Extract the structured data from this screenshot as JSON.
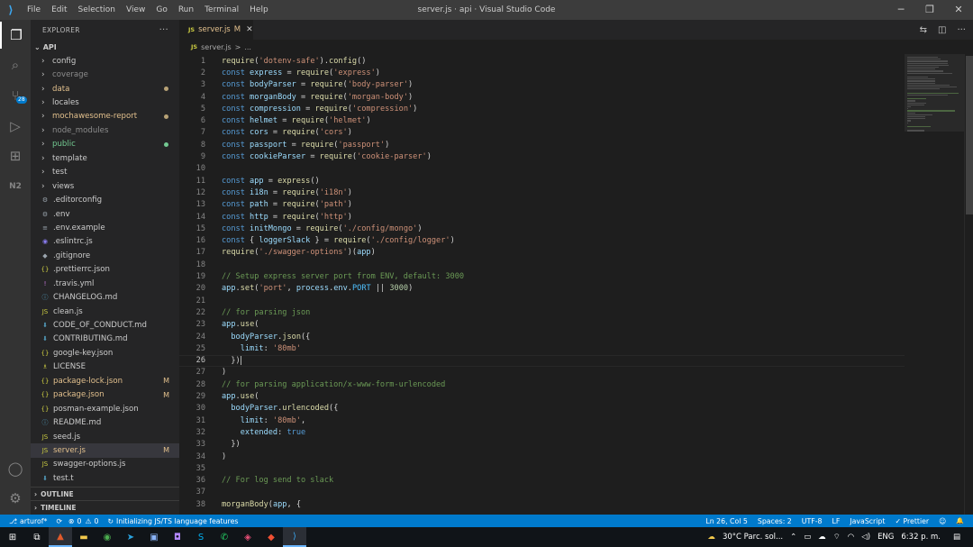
{
  "titlebar": {
    "menu": [
      "File",
      "Edit",
      "Selection",
      "View",
      "Go",
      "Run",
      "Terminal",
      "Help"
    ],
    "title": "server.js · api · Visual Studio Code",
    "icons": [
      "minimize-icon",
      "restore-icon",
      "close-icon"
    ]
  },
  "activity": {
    "icons": [
      "files-icon",
      "search-icon",
      "source-control-icon",
      "run-debug-icon",
      "extensions-icon",
      "api-icon",
      "account-icon",
      "manage-gear-icon"
    ],
    "scm_badge": "28"
  },
  "sidebar": {
    "title": "EXPLORER",
    "more": "···",
    "root": "API",
    "items": [
      {
        "label": "config",
        "type": "folder",
        "color": "#cccccc"
      },
      {
        "label": "coverage",
        "type": "folder",
        "color": "#8c8c8c"
      },
      {
        "label": "data",
        "type": "folder",
        "color": "#e2c08d",
        "dot": "#b8a276"
      },
      {
        "label": "locales",
        "type": "folder",
        "color": "#cccccc"
      },
      {
        "label": "mochawesome-report",
        "type": "folder",
        "color": "#e2c08d",
        "dot": "#b8a276"
      },
      {
        "label": "node_modules",
        "type": "folder",
        "color": "#8c8c8c"
      },
      {
        "label": "public",
        "type": "folder",
        "color": "#73c991",
        "dot": "#73c991"
      },
      {
        "label": "template",
        "type": "folder",
        "color": "#cccccc"
      },
      {
        "label": "test",
        "type": "folder",
        "color": "#cccccc"
      },
      {
        "label": "views",
        "type": "folder",
        "color": "#cccccc"
      },
      {
        "label": ".editorconfig",
        "type": "file",
        "icon": "⚙",
        "icon_color": "#9aa4ad",
        "color": "#cccccc"
      },
      {
        "label": ".env",
        "type": "file",
        "icon": "⚙",
        "icon_color": "#9aa4ad",
        "color": "#cccccc"
      },
      {
        "label": ".env.example",
        "type": "file",
        "icon": "≡",
        "icon_color": "#9aa4ad",
        "color": "#cccccc"
      },
      {
        "label": ".eslintrc.js",
        "type": "file",
        "icon": "◉",
        "icon_color": "#8a7cf0",
        "color": "#cccccc"
      },
      {
        "label": ".gitignore",
        "type": "file",
        "icon": "◆",
        "icon_color": "#9aa4ad",
        "color": "#cccccc"
      },
      {
        "label": ".prettierrc.json",
        "type": "file",
        "icon": "{}",
        "icon_color": "#cbcb41",
        "color": "#cccccc"
      },
      {
        "label": ".travis.yml",
        "type": "file",
        "icon": "!",
        "icon_color": "#c678dd",
        "color": "#cccccc"
      },
      {
        "label": "CHANGELOG.md",
        "type": "file",
        "icon": "ⓘ",
        "icon_color": "#519aba",
        "color": "#cccccc"
      },
      {
        "label": "clean.js",
        "type": "file",
        "icon": "JS",
        "icon_color": "#cbcb41",
        "color": "#cccccc"
      },
      {
        "label": "CODE_OF_CONDUCT.md",
        "type": "file",
        "icon": "⬇",
        "icon_color": "#519aba",
        "color": "#cccccc"
      },
      {
        "label": "CONTRIBUTING.md",
        "type": "file",
        "icon": "⬇",
        "icon_color": "#519aba",
        "color": "#cccccc"
      },
      {
        "label": "google-key.json",
        "type": "file",
        "icon": "{}",
        "icon_color": "#cbcb41",
        "color": "#cccccc"
      },
      {
        "label": "LICENSE",
        "type": "file",
        "icon": "♗",
        "icon_color": "#cbcb41",
        "color": "#cccccc"
      },
      {
        "label": "package-lock.json",
        "type": "file",
        "icon": "{}",
        "icon_color": "#cbcb41",
        "color": "#e2c08d",
        "deco": "M"
      },
      {
        "label": "package.json",
        "type": "file",
        "icon": "{}",
        "icon_color": "#cbcb41",
        "color": "#e2c08d",
        "deco": "M"
      },
      {
        "label": "posman-example.json",
        "type": "file",
        "icon": "{}",
        "icon_color": "#cbcb41",
        "color": "#cccccc"
      },
      {
        "label": "README.md",
        "type": "file",
        "icon": "ⓘ",
        "icon_color": "#519aba",
        "color": "#cccccc"
      },
      {
        "label": "seed.js",
        "type": "file",
        "icon": "JS",
        "icon_color": "#cbcb41",
        "color": "#cccccc"
      },
      {
        "label": "server.js",
        "type": "file",
        "icon": "JS",
        "icon_color": "#cbcb41",
        "color": "#e2c08d",
        "deco": "M",
        "selected": true
      },
      {
        "label": "swagger-options.js",
        "type": "file",
        "icon": "JS",
        "icon_color": "#cbcb41",
        "color": "#cccccc"
      },
      {
        "label": "test.t",
        "type": "file",
        "icon": "⬇",
        "icon_color": "#519aba",
        "color": "#cccccc"
      }
    ],
    "outline": "OUTLINE",
    "timeline": "TIMELINE"
  },
  "tab": {
    "icon": "JS",
    "name": "server.js",
    "status": "M",
    "close": "✕"
  },
  "breadcrumb": {
    "icon": "JS",
    "file": "server.js",
    "sep": ">",
    "rest": "..."
  },
  "editor_action_icons": [
    "compare-icon",
    "split-editor-icon",
    "more-actions-icon"
  ],
  "code": {
    "current_line": 26,
    "lines": [
      [
        [
          "f",
          "require"
        ],
        [
          "p",
          "("
        ],
        [
          "s",
          "'dotenv-safe'"
        ],
        [
          "p",
          ")."
        ],
        [
          "f",
          "config"
        ],
        [
          "p",
          "()"
        ]
      ],
      [
        [
          "k",
          "const "
        ],
        [
          "v",
          "express"
        ],
        [
          "p",
          " = "
        ],
        [
          "f",
          "require"
        ],
        [
          "p",
          "("
        ],
        [
          "s",
          "'express'"
        ],
        [
          "p",
          ")"
        ]
      ],
      [
        [
          "k",
          "const "
        ],
        [
          "v",
          "bodyParser"
        ],
        [
          "p",
          " = "
        ],
        [
          "f",
          "require"
        ],
        [
          "p",
          "("
        ],
        [
          "s",
          "'body-parser'"
        ],
        [
          "p",
          ")"
        ]
      ],
      [
        [
          "k",
          "const "
        ],
        [
          "v",
          "morganBody"
        ],
        [
          "p",
          " = "
        ],
        [
          "f",
          "require"
        ],
        [
          "p",
          "("
        ],
        [
          "s",
          "'morgan-body'"
        ],
        [
          "p",
          ")"
        ]
      ],
      [
        [
          "k",
          "const "
        ],
        [
          "v",
          "compression"
        ],
        [
          "p",
          " = "
        ],
        [
          "f",
          "require"
        ],
        [
          "p",
          "("
        ],
        [
          "s",
          "'compression'"
        ],
        [
          "p",
          ")"
        ]
      ],
      [
        [
          "k",
          "const "
        ],
        [
          "v",
          "helmet"
        ],
        [
          "p",
          " = "
        ],
        [
          "f",
          "require"
        ],
        [
          "p",
          "("
        ],
        [
          "s",
          "'helmet'"
        ],
        [
          "p",
          ")"
        ]
      ],
      [
        [
          "k",
          "const "
        ],
        [
          "v",
          "cors"
        ],
        [
          "p",
          " = "
        ],
        [
          "f",
          "require"
        ],
        [
          "p",
          "("
        ],
        [
          "s",
          "'cors'"
        ],
        [
          "p",
          ")"
        ]
      ],
      [
        [
          "k",
          "const "
        ],
        [
          "v",
          "passport"
        ],
        [
          "p",
          " = "
        ],
        [
          "f",
          "require"
        ],
        [
          "p",
          "("
        ],
        [
          "s",
          "'passport'"
        ],
        [
          "p",
          ")"
        ]
      ],
      [
        [
          "k",
          "const "
        ],
        [
          "v",
          "cookieParser"
        ],
        [
          "p",
          " = "
        ],
        [
          "f",
          "require"
        ],
        [
          "p",
          "("
        ],
        [
          "s",
          "'cookie-parser'"
        ],
        [
          "p",
          ")"
        ]
      ],
      [],
      [
        [
          "k",
          "const "
        ],
        [
          "v",
          "app"
        ],
        [
          "p",
          " = "
        ],
        [
          "f",
          "express"
        ],
        [
          "p",
          "()"
        ]
      ],
      [
        [
          "k",
          "const "
        ],
        [
          "v",
          "i18n"
        ],
        [
          "p",
          " = "
        ],
        [
          "f",
          "require"
        ],
        [
          "p",
          "("
        ],
        [
          "s",
          "'i18n'"
        ],
        [
          "p",
          ")"
        ]
      ],
      [
        [
          "k",
          "const "
        ],
        [
          "v",
          "path"
        ],
        [
          "p",
          " = "
        ],
        [
          "f",
          "require"
        ],
        [
          "p",
          "("
        ],
        [
          "s",
          "'path'"
        ],
        [
          "p",
          ")"
        ]
      ],
      [
        [
          "k",
          "const "
        ],
        [
          "v",
          "http"
        ],
        [
          "p",
          " = "
        ],
        [
          "f",
          "require"
        ],
        [
          "p",
          "("
        ],
        [
          "s",
          "'http'"
        ],
        [
          "p",
          ")"
        ]
      ],
      [
        [
          "k",
          "const "
        ],
        [
          "v",
          "initMongo"
        ],
        [
          "p",
          " = "
        ],
        [
          "f",
          "require"
        ],
        [
          "p",
          "("
        ],
        [
          "s",
          "'./config/mongo'"
        ],
        [
          "p",
          ")"
        ]
      ],
      [
        [
          "k",
          "const "
        ],
        [
          "p",
          "{ "
        ],
        [
          "v",
          "loggerSlack"
        ],
        [
          "p",
          " } = "
        ],
        [
          "f",
          "require"
        ],
        [
          "p",
          "("
        ],
        [
          "s",
          "'./config/logger'"
        ],
        [
          "p",
          ")"
        ]
      ],
      [
        [
          "f",
          "require"
        ],
        [
          "p",
          "("
        ],
        [
          "s",
          "'./swagger-options'"
        ],
        [
          "p",
          ")("
        ],
        [
          "v",
          "app"
        ],
        [
          "p",
          ")"
        ]
      ],
      [],
      [
        [
          "c",
          "// Setup express server port from ENV, default: 3000"
        ]
      ],
      [
        [
          "v",
          "app"
        ],
        [
          "p",
          "."
        ],
        [
          "f",
          "set"
        ],
        [
          "p",
          "("
        ],
        [
          "s",
          "'port'"
        ],
        [
          "p",
          ", "
        ],
        [
          "v",
          "process"
        ],
        [
          "p",
          "."
        ],
        [
          "v",
          "env"
        ],
        [
          "p",
          "."
        ],
        [
          "kw2",
          "PORT"
        ],
        [
          "p",
          " || "
        ],
        [
          "n",
          "3000"
        ],
        [
          "p",
          ")"
        ]
      ],
      [],
      [
        [
          "c",
          "// for parsing json"
        ]
      ],
      [
        [
          "v",
          "app"
        ],
        [
          "p",
          "."
        ],
        [
          "f",
          "use"
        ],
        [
          "p",
          "("
        ]
      ],
      [
        [
          "p",
          "  "
        ],
        [
          "v",
          "bodyParser"
        ],
        [
          "p",
          "."
        ],
        [
          "f",
          "json"
        ],
        [
          "p",
          "({"
        ]
      ],
      [
        [
          "p",
          "    "
        ],
        [
          "v",
          "limit"
        ],
        [
          "p",
          ": "
        ],
        [
          "s",
          "'80mb'"
        ]
      ],
      [
        [
          "p",
          "  })"
        ]
      ],
      [
        [
          "p",
          ")"
        ]
      ],
      [
        [
          "c",
          "// for parsing application/x-www-form-urlencoded"
        ]
      ],
      [
        [
          "v",
          "app"
        ],
        [
          "p",
          "."
        ],
        [
          "f",
          "use"
        ],
        [
          "p",
          "("
        ]
      ],
      [
        [
          "p",
          "  "
        ],
        [
          "v",
          "bodyParser"
        ],
        [
          "p",
          "."
        ],
        [
          "f",
          "urlencoded"
        ],
        [
          "p",
          "({"
        ]
      ],
      [
        [
          "p",
          "    "
        ],
        [
          "v",
          "limit"
        ],
        [
          "p",
          ": "
        ],
        [
          "s",
          "'80mb'"
        ],
        [
          "p",
          ","
        ]
      ],
      [
        [
          "p",
          "    "
        ],
        [
          "v",
          "extended"
        ],
        [
          "p",
          ": "
        ],
        [
          "k",
          "true"
        ]
      ],
      [
        [
          "p",
          "  })"
        ]
      ],
      [
        [
          "p",
          ")"
        ]
      ],
      [],
      [
        [
          "c",
          "// For log send to slack"
        ]
      ],
      [],
      [
        [
          "f",
          "morganBody"
        ],
        [
          "p",
          "("
        ],
        [
          "v",
          "app"
        ],
        [
          "p",
          ", {"
        ]
      ]
    ]
  },
  "statusbar": {
    "left": [
      {
        "icon": "branch-icon",
        "glyph": "⎇",
        "text": "arturof*"
      },
      {
        "icon": "sync-icon",
        "glyph": "⟳",
        "text": ""
      },
      {
        "icon": "errors-icon",
        "glyph": "⊗",
        "text": "0"
      },
      {
        "icon": "warnings-icon",
        "glyph": "⚠",
        "text": "0"
      },
      {
        "icon": "loading-icon",
        "glyph": "↻",
        "text": "Initializing JS/TS language features"
      }
    ],
    "right": [
      "Ln 26, Col 5",
      "Spaces: 2",
      "UTF-8",
      "LF",
      "JavaScript",
      "✓ Prettier"
    ],
    "right_icons": [
      "feedback-icon",
      "notifications-bell-icon"
    ]
  },
  "taskbar": {
    "icons": [
      "windows-start-icon",
      "task-view-icon",
      "app-icon",
      "file-explorer-icon",
      "chrome-icon",
      "telegram-icon",
      "app-icon-2",
      "app-icon-3",
      "skype-icon",
      "whatsapp-icon",
      "app-icon-4",
      "git-icon",
      "vscode-icon"
    ],
    "weather": "30°C  Parc. sol...",
    "lang": "ENG",
    "time": "6:32 p. m."
  }
}
